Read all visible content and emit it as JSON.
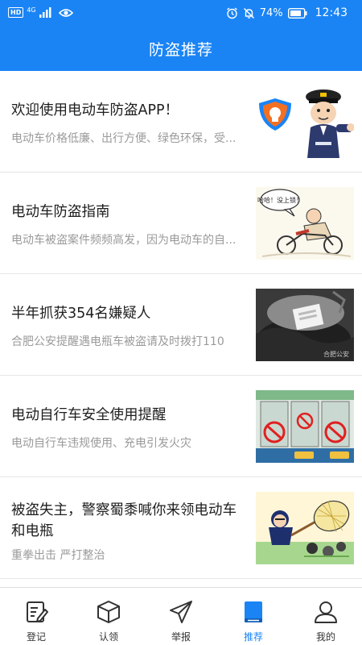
{
  "status_bar": {
    "hd": "HD",
    "network": "4G",
    "battery": "74%",
    "time": "12:43"
  },
  "header": {
    "title": "防盗推荐"
  },
  "articles": [
    {
      "title": "欢迎使用电动车防盗APP！",
      "desc": "电动车价格低廉、出行方便、绿色环保，受..."
    },
    {
      "title": "电动车防盗指南",
      "desc": "电动车被盗案件频频高发，因为电动车的自..."
    },
    {
      "title": "半年抓获354名嫌疑人",
      "desc": "合肥公安提醒遇电瓶车被盗请及时拨打110"
    },
    {
      "title": "电动自行车安全使用提醒",
      "desc": "电动自行车违规使用、充电引发火灾"
    },
    {
      "title": "被盗失主，警察蜀黍喊你来领电动车和电瓶",
      "desc": "重拳出击 严打整治"
    }
  ],
  "thumbnails": {
    "speech_bubble": "哈哈！没上锁！",
    "watermark": "合肥公安"
  },
  "tabs": [
    {
      "label": "登记",
      "icon": "edit-document-icon"
    },
    {
      "label": "认领",
      "icon": "box-icon"
    },
    {
      "label": "举报",
      "icon": "paper-plane-icon"
    },
    {
      "label": "推荐",
      "icon": "book-icon"
    },
    {
      "label": "我的",
      "icon": "user-icon"
    }
  ],
  "colors": {
    "primary": "#1a84f5",
    "title_text": "#1e1e1e",
    "desc_text": "#9a9a9a"
  }
}
